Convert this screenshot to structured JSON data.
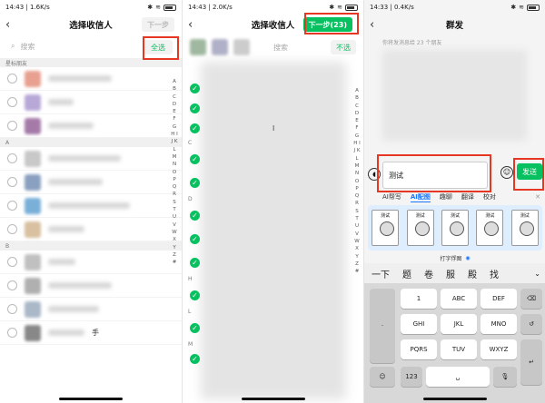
{
  "p1": {
    "time": "14:43",
    "speed": "1.6K/s",
    "title": "选择收信人",
    "next": "下一步",
    "search_ph": "搜索",
    "select_all": "全选",
    "section_star": "星标朋友",
    "section_a": "A",
    "section_b": "B",
    "idx": "A B C D E F G H I J K L M N O P Q R S T U V W X Y Z #",
    "last_name": "手"
  },
  "p2": {
    "time": "14:43",
    "speed": "2.0K/s",
    "title": "选择收信人",
    "next": "下一步(23)",
    "search_ph": "搜索",
    "deselect": "不选",
    "sec_c": "C",
    "sec_d": "D",
    "sec_h": "H",
    "sec_l": "L",
    "sec_m": "M",
    "tail": "l"
  },
  "p3": {
    "time": "14:33",
    "speed": "0.4K/s",
    "title": "群发",
    "hint": "你将发消息给 23 个朋友",
    "input": "测试",
    "send": "发送",
    "tools": [
      "AI帮写",
      "AI配图",
      "趣聊",
      "翻译",
      "校对"
    ],
    "stickers": [
      "测试",
      "测试",
      "测试",
      "测试",
      "测试"
    ],
    "cloud": "打字俘图",
    "cands": [
      "一下",
      "题",
      "卷",
      "服",
      "殿",
      "找"
    ],
    "keys": [
      "1",
      "ABC",
      "DEF",
      "GHI",
      "JKL",
      "MNO",
      "PQRS",
      "TUV",
      "WXYZ",
      "123"
    ]
  },
  "accent": "#07c160",
  "mark_color": "#e53723"
}
